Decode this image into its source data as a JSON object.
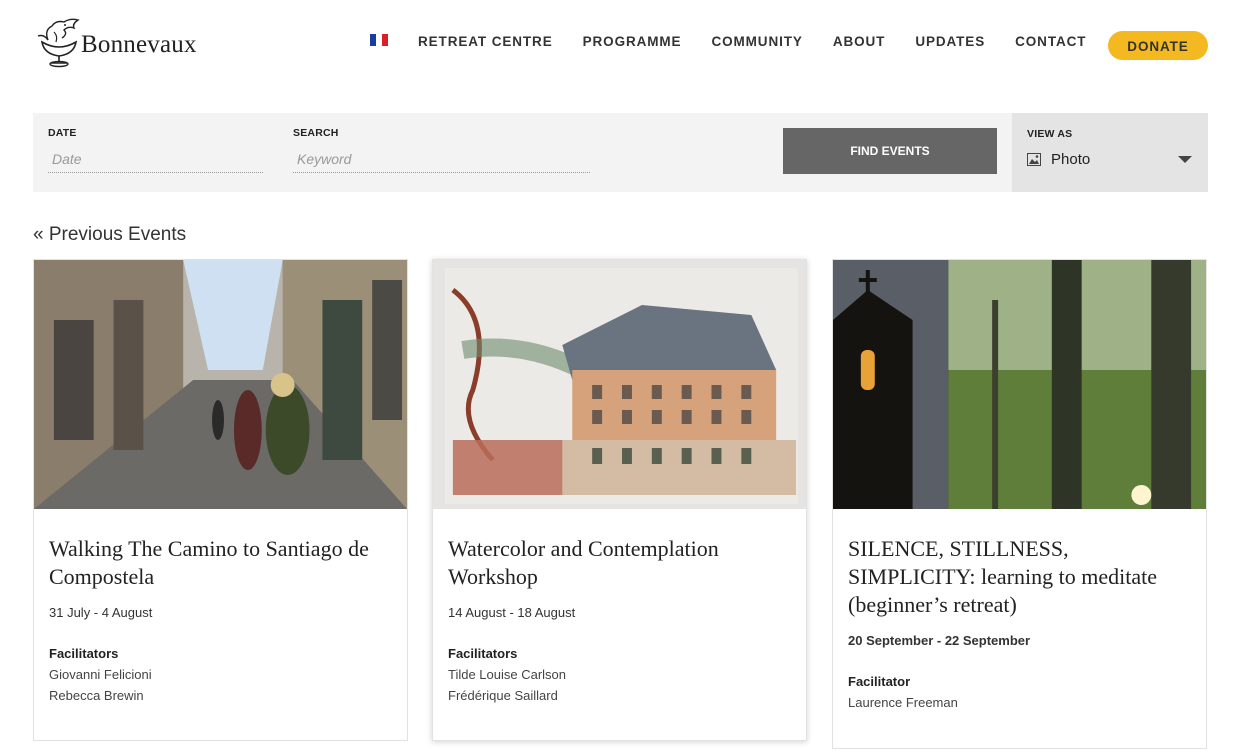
{
  "header": {
    "logo_text": "Bonnevaux",
    "nav": [
      "RETREAT CENTRE",
      "PROGRAMME",
      "COMMUNITY",
      "ABOUT",
      "UPDATES",
      "CONTACT"
    ],
    "donate_label": "DONATE",
    "flag_colors": [
      "#1a3c9e",
      "#ffffff",
      "#d8202a"
    ]
  },
  "filters": {
    "date_label": "DATE",
    "date_placeholder": "Date",
    "search_label": "SEARCH",
    "search_placeholder": "Keyword",
    "find_label": "FIND EVENTS",
    "view_label": "VIEW AS",
    "view_value": "Photo"
  },
  "prev_link": "« Previous Events",
  "events": [
    {
      "title": "Walking The Camino to Santiago de Compostela",
      "date": "31 July - 4 August",
      "fac_label": "Facilitators",
      "facilitators": [
        "Giovanni Felicioni",
        "Rebecca Brewin"
      ]
    },
    {
      "title": "Watercolor and Contemplation Workshop",
      "date": "14 August - 18 August",
      "fac_label": "Facilitators",
      "facilitators": [
        "Tilde Louise Carlson",
        "Frédérique Saillard"
      ]
    },
    {
      "title": "SILENCE, STILLNESS, SIMPLICITY: learning to meditate (beginner’s retreat)",
      "date": "20 September - 22 September",
      "fac_label": "Facilitator",
      "facilitators": [
        "Laurence Freeman"
      ]
    }
  ],
  "colors": {
    "accent_donate": "#f4b920",
    "find_button": "#666666",
    "filter_bg": "#f3f3f3"
  }
}
